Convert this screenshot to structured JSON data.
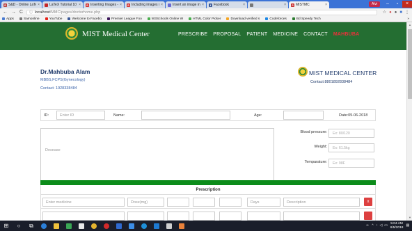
{
  "browser": {
    "tabs": [
      {
        "label": "S&D - Online LaTeX",
        "favicon_color": "#b73b3b",
        "fav_letter": "S"
      },
      {
        "label": "LaTeX Tutorial 10 Ins",
        "favicon_color": "#c62828",
        "fav_letter": ""
      },
      {
        "label": "Inserting Images - ",
        "favicon_color": "#d32f2f",
        "fav_letter": "S"
      },
      {
        "label": "Including images in",
        "favicon_color": "#d32f2f",
        "fav_letter": "S"
      },
      {
        "label": "Insert an image in",
        "favicon_color": "#6b6bd6",
        "fav_letter": ""
      },
      {
        "label": "Facebook",
        "favicon_color": "#3b5998",
        "fav_letter": "f"
      },
      {
        "label": "",
        "favicon_color": "#777777",
        "fav_letter": ""
      },
      {
        "label": "MISTMC",
        "favicon_color": "#c62828",
        "fav_letter": "S"
      }
    ],
    "active_tab_index": 7,
    "user_badge": "Alvi",
    "url_host": "localhost",
    "url_path": "/MMC/pages/doctorhome.php",
    "bookmarks": [
      {
        "label": "Apps",
        "color": "#4a7bd0"
      },
      {
        "label": "Samonline",
        "color": "#777777"
      },
      {
        "label": "YouTube",
        "color": "#e62117"
      },
      {
        "label": "Welcome to Facebo",
        "color": "#3b5998"
      },
      {
        "label": "Premier League Foo",
        "color": "#3d195b"
      },
      {
        "label": "W3Schools Online W",
        "color": "#4caf50"
      },
      {
        "label": "HTML Color Picker",
        "color": "#4caf50"
      },
      {
        "label": "Download verified s",
        "color": "#f5a623"
      },
      {
        "label": "Codeforces",
        "color": "#1e88e5"
      },
      {
        "label": "Bd Speedy Tech",
        "color": "#2e7d32"
      }
    ],
    "more_bookmarks": "»"
  },
  "site": {
    "brand": "MIST Medical Center",
    "nav": [
      "PRESCRIBE",
      "PROPOSAL",
      "PATIENT",
      "MEDICINE",
      "CONTACT"
    ],
    "nav_user": "MAHBUBA",
    "nav_color": "#246e32",
    "accent_red": "#e8313a"
  },
  "doctor": {
    "name": "Dr.Mahbuba Alam",
    "degree": "MBBS,FCPS(Gynecology)",
    "contact": "Contact: 1928338484"
  },
  "center": {
    "name": "MIST MEDICAL CENTER",
    "contact": "Contact:8801892838484"
  },
  "patient": {
    "id_label": "ID:",
    "id_placeholder": "Enter ID",
    "name_label": "Name:",
    "age_label": "Age:",
    "date": "Date:05-06-2018"
  },
  "symptoms": {
    "disease_placeholder": "Desease",
    "bp_label": "Blood pressure:",
    "bp_placeholder": "Ex: 80/120",
    "weight_label": "Weight:",
    "weight_placeholder": "Ex: 61.5kg",
    "temp_label": "Temparature:",
    "temp_placeholder": "Ex: 98F"
  },
  "prescription": {
    "title": "Prescription",
    "medicine_placeholder": "Enter medicine",
    "dose_placeholder": "Dose(mg)",
    "days_placeholder": "Days",
    "description_placeholder": "Description",
    "delete_label": "x"
  },
  "taskbar": {
    "time": "5:04 AM",
    "date": "6/5/2018"
  }
}
